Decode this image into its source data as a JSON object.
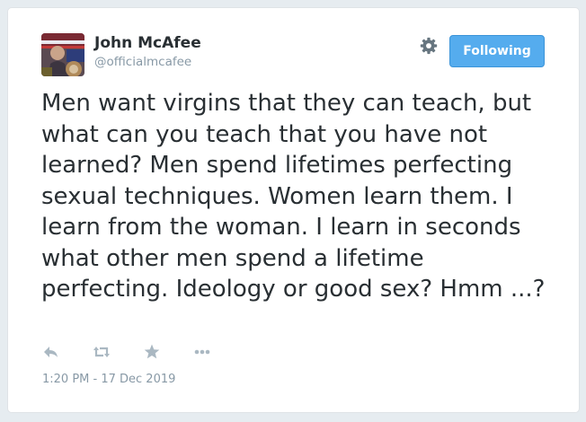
{
  "user": {
    "name": "John McAfee",
    "handle": "@officialmcafee"
  },
  "follow_button": {
    "label": "Following"
  },
  "tweet": {
    "text": "Men want virgins that they can teach, but what can you teach that you have not learned? Men spend lifetimes perfecting sexual techniques. Women learn them. I learn from the woman. I learn in seconds what other men spend a lifetime perfecting. Ideology or good sex? Hmm ...?",
    "timestamp": "1:20 PM - 17 Dec 2019"
  },
  "icons": {
    "settings": "gear-icon",
    "reply": "reply-icon",
    "retweet": "retweet-icon",
    "like": "star-icon",
    "more": "more-icon"
  },
  "colors": {
    "accent": "#55acee",
    "text": "#292f33",
    "muted": "#8899a6",
    "icon": "#aab8c2"
  }
}
